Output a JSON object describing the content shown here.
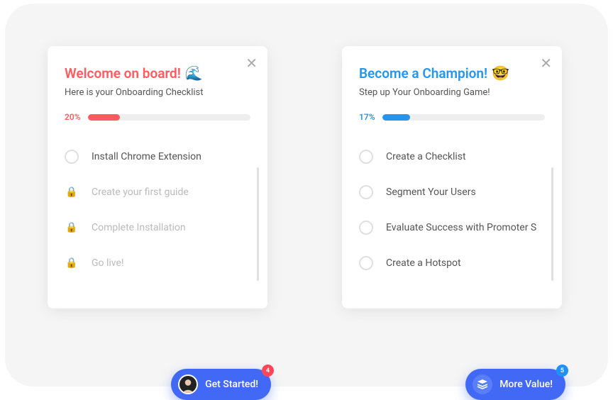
{
  "cards": [
    {
      "title": "Welcome on board!",
      "emoji": "🌊",
      "subtitle": "Here is your Onboarding Checklist",
      "progress": "20%",
      "items": [
        {
          "label": "Install Chrome Extension",
          "locked": false
        },
        {
          "label": "Create your first guide",
          "locked": true
        },
        {
          "label": "Complete Installation",
          "locked": true
        },
        {
          "label": "Go live!",
          "locked": true
        }
      ],
      "cta": {
        "label": "Get Started!",
        "badge": "4"
      }
    },
    {
      "title": "Become a Champion!",
      "emoji": "🤓",
      "subtitle": "Step up Your Onboarding Game!",
      "progress": "17%",
      "items": [
        {
          "label": "Create a Checklist",
          "locked": false
        },
        {
          "label": "Segment Your Users",
          "locked": false
        },
        {
          "label": "Evaluate Success with Promoter S",
          "locked": false
        },
        {
          "label": "Create a Hotspot",
          "locked": false
        }
      ],
      "cta": {
        "label": "More Value!",
        "badge": "5"
      }
    }
  ]
}
